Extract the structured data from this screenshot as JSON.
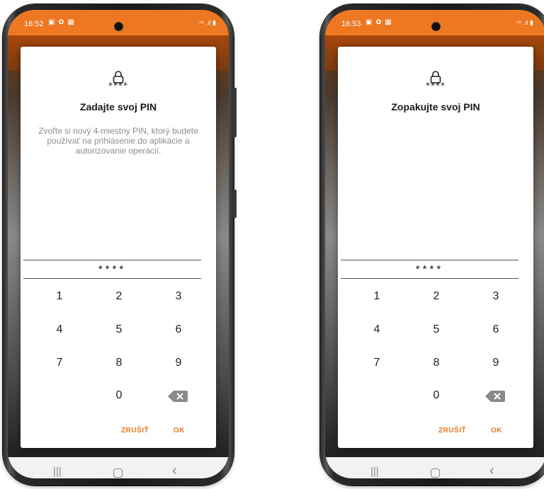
{
  "screens": [
    {
      "statusbar": {
        "time": "16:52",
        "notification_icons": "▣ ✿ ▦",
        "system_icons": "⁴⁶ .ıl ▮"
      },
      "dialog": {
        "pin_glyph": "****",
        "title": "Zadajte svoj PIN",
        "description": "Zvoľte si nový 4-miestny PIN, ktorý budete používať na prihlásenie do aplikácie a autorizovanie operácií.",
        "pin_display": "****",
        "keys": [
          "1",
          "2",
          "3",
          "4",
          "5",
          "6",
          "7",
          "8",
          "9",
          "0"
        ],
        "cancel_label": "ZRUŠIŤ",
        "ok_label": "OK"
      },
      "navbar": {
        "recents": "|||",
        "back": "‹"
      }
    },
    {
      "statusbar": {
        "time": "16:53",
        "notification_icons": "▣ ✿ ▦",
        "system_icons": "⁴⁶ .ıl ▮"
      },
      "dialog": {
        "pin_glyph": "****",
        "title": "Zopakujte svoj PIN",
        "description": "",
        "pin_display": "****",
        "keys": [
          "1",
          "2",
          "3",
          "4",
          "5",
          "6",
          "7",
          "8",
          "9",
          "0"
        ],
        "cancel_label": "ZRUŠIŤ",
        "ok_label": "OK"
      },
      "navbar": {
        "recents": "|||",
        "back": "‹"
      }
    }
  ],
  "colors": {
    "accent": "#ee7722",
    "statusbar": "#ee7722",
    "text_primary": "#1a1a1a",
    "text_secondary": "#8d8d8d"
  }
}
